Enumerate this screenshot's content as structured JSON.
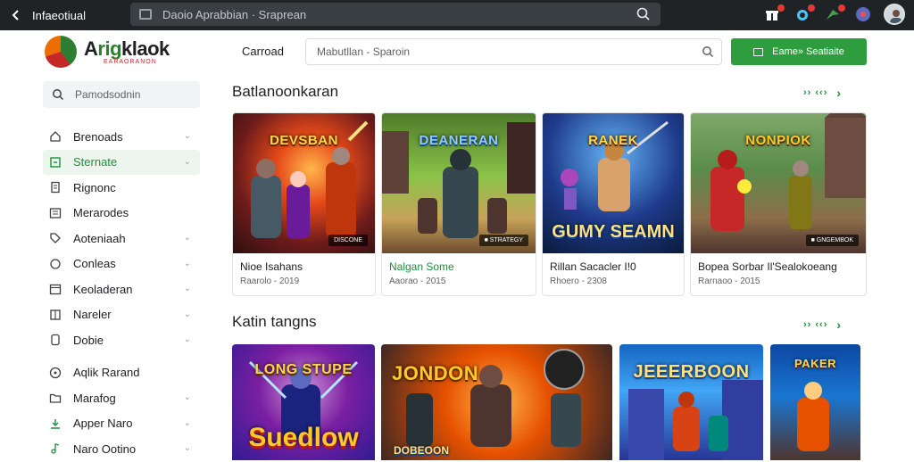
{
  "topbar": {
    "back_icon": "back-arrow-icon",
    "title": "Infaeotiual",
    "address": "Daoio Aprabbian · Sraprean",
    "icons": [
      "gift-icon",
      "shop-icon",
      "flag-icon",
      "globe-icon"
    ]
  },
  "logo": {
    "name_prefix": "A",
    "name_mid": "rig",
    "name_suffix": "klaok",
    "subtitle": "EARAORANON"
  },
  "sidebar": {
    "search_placeholder": "Pamodsodnin",
    "items": [
      {
        "label": "Brenoads",
        "icon": "home-icon",
        "chevron": true,
        "active": false
      },
      {
        "label": "Sternate",
        "icon": "box-icon",
        "chevron": true,
        "active": true
      },
      {
        "label": "Rignonc",
        "icon": "document-icon",
        "chevron": false,
        "active": false
      },
      {
        "label": "Merarodes",
        "icon": "list-icon",
        "chevron": false,
        "active": false
      },
      {
        "label": "Aoteniaah",
        "icon": "tag-icon",
        "chevron": true,
        "active": false
      },
      {
        "label": "Conleas",
        "icon": "chat-icon",
        "chevron": true,
        "active": false
      },
      {
        "label": "Keoladeran",
        "icon": "calendar-icon",
        "chevron": true,
        "active": false
      },
      {
        "label": "Nareler",
        "icon": "grid-icon",
        "chevron": true,
        "active": false
      },
      {
        "label": "Dobie",
        "icon": "book-icon",
        "chevron": true,
        "active": false
      },
      {
        "label": "Aqlik Rarand",
        "icon": "settings-circle-icon",
        "chevron": false,
        "active": false,
        "gap": true
      },
      {
        "label": "Marafog",
        "icon": "folder-icon",
        "chevron": true,
        "active": false
      },
      {
        "label": "Apper Naro",
        "icon": "download-icon",
        "chevron": true,
        "active": false
      },
      {
        "label": "Naro Ootino",
        "icon": "music-icon",
        "chevron": true,
        "active": false
      }
    ]
  },
  "header": {
    "category_label": "Carroad",
    "search_placeholder": "Mabutllan - Sparoin",
    "action_button": "Eame» Seatiaite"
  },
  "section1": {
    "title": "Batlanoonkaran",
    "more": "›› ‹‹›",
    "cards": [
      {
        "art_title": "DEVSBAN",
        "badge": "DISCONE",
        "title": "Nioe Isahans",
        "meta": "Raarolo - 2019",
        "green": false
      },
      {
        "art_title": "DEANERAN",
        "badge": "■ STRATEGY",
        "title": "Nalgan Some",
        "meta": "Aaorao - 2015",
        "green": true
      },
      {
        "art_title": "RANEK",
        "badge": "",
        "big_text": "GUMY SEAMN",
        "title": "Rillan Sacacler I!0",
        "meta": "Rhoero - 2308",
        "green": false
      },
      {
        "art_title": "NONPIOK",
        "badge": "■ GNGEMBOK",
        "title": "Bopea Sorbar Il'Sealokoeang",
        "meta": "Rarnaoo - 2015",
        "green": false
      }
    ]
  },
  "section2": {
    "title": "Katin tangns",
    "more": "›› ‹‹›",
    "cards": [
      {
        "art_title": "LONG STUPE",
        "big_text": "Suedlow"
      },
      {
        "art_title": "JONDON",
        "big_text": "DOBEOON"
      },
      {
        "art_title": "JEEERBOON",
        "big_text": ""
      },
      {
        "art_title": "PAKER",
        "big_text": ""
      }
    ]
  },
  "colors": {
    "accent": "#2e9d3e",
    "topbar": "#1f2326"
  }
}
